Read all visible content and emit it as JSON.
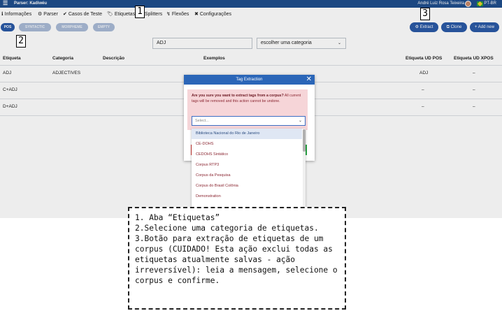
{
  "topbar": {
    "title": "Parser: Kadiwéu",
    "user": "André Luiz Rosa Teixeira",
    "lang": "PT-BR"
  },
  "nav": {
    "items": [
      {
        "label": "Informações",
        "icon": "info-icon"
      },
      {
        "label": "Parser",
        "icon": "parser-icon"
      },
      {
        "label": "Casos de Teste",
        "icon": "check-circle-icon"
      },
      {
        "label": "Etiquetas",
        "icon": "tag-icon"
      },
      {
        "label": "Splitters",
        "icon": "splitter-icon"
      },
      {
        "label": "Flexões",
        "icon": "flexion-icon"
      },
      {
        "label": "Configurações",
        "icon": "tools-icon"
      }
    ]
  },
  "categories": [
    "POS",
    "SYNTACTIC",
    "MORPHEME",
    "EMPTY"
  ],
  "actions": {
    "extract": "Extract",
    "clone": "Clone",
    "add_new": "+ Add new"
  },
  "search": {
    "value": "ADJ",
    "category_placeholder": "escolher uma categoria"
  },
  "table": {
    "columns": [
      "Etiqueta",
      "Categoria",
      "Descrição",
      "Exemplos",
      "Etiqueta UD POS",
      "Etiqueta UD XPOS"
    ],
    "rows": [
      [
        "ADJ",
        "ADJECTIVES",
        "",
        "",
        "ADJ",
        "–"
      ],
      [
        "C+ADJ",
        "",
        "",
        "",
        "–",
        "–"
      ],
      [
        "D+ADJ",
        "",
        "",
        "",
        "–",
        "–"
      ]
    ]
  },
  "modal": {
    "title": "Tag Extraction",
    "alert_bold": "Are you sure you want to extract tags from a corpus?",
    "alert_rest": " All current tags will be removed and this action cannot be undone.",
    "select_placeholder": "Select..."
  },
  "dropdown": {
    "options": [
      "Biblioteca Nacional do Rio de Janeiro",
      "CE-DOHS",
      "CEDOHS Sintático",
      "Corpus RTP3",
      "Corpus da Pesquisa",
      "Corpus do Brasil Colônia",
      "Demonstration",
      ""
    ]
  },
  "markers": [
    "1",
    "2",
    "3"
  ],
  "note": {
    "text": "1. Aba “Etiquetas”\n2.Selecione uma categoria de etiquetas.\n3.Botão para extração de etiquetas de um corpus (CUIDADO! Esta ação exclui todas as etiquetas atualmente salvas - ação irreversível): leia a mensagem, selecione o corpus e confirme."
  },
  "colors": {
    "primary": "#2b5aa6",
    "header": "#1f4e8c",
    "alert_bg": "#f6d5d8",
    "danger": "#c9302c",
    "success": "#28a745"
  }
}
